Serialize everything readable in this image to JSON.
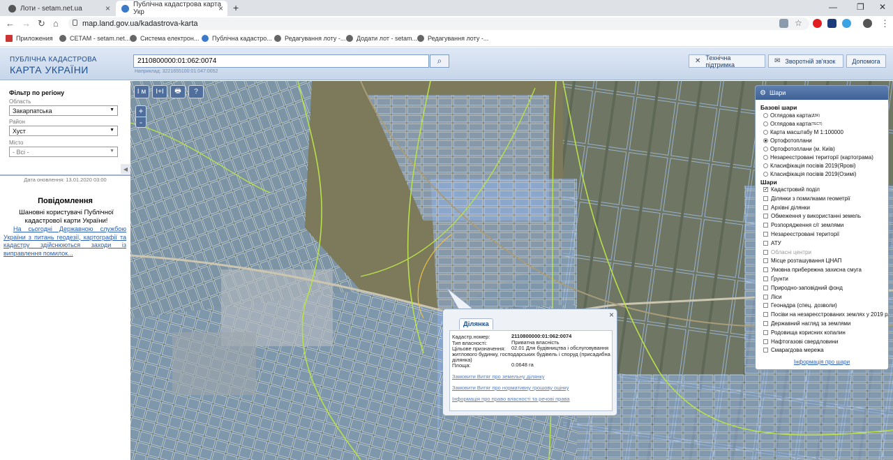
{
  "browser": {
    "tabs": [
      {
        "title": "Лоти - setam.net.ua"
      },
      {
        "title": "Публічна кадастрова карта Укр"
      }
    ],
    "new_tab": "+",
    "url": "map.land.gov.ua/kadastrova-karta",
    "bookmarks": [
      "Приложения",
      "СЕТАМ - setam.net...",
      "Система електрон...",
      "Публічна кадастро...",
      "Редагування лоту -...",
      "Додати лот - setam...",
      "Редагування лоту -..."
    ]
  },
  "header": {
    "logo_line1": "ПУБЛІЧНА КАДАСТРОВА",
    "logo_line2": "КАРТА УКРАЇНИ",
    "search_value": "2110800000:01:062:0074",
    "search_hint": "Наприклад: 3221655100:01:047:0052",
    "buttons": [
      "Технічна підтримка",
      "Зворотній зв'язок",
      "Допомога"
    ]
  },
  "filter": {
    "title": "Фільтр по регіону",
    "oblast_label": "Область",
    "oblast_value": "Закарпатська",
    "rayon_label": "Район",
    "rayon_value": "Хуст",
    "misto_label": "Місто",
    "misto_value": "- Всі -"
  },
  "left_panel": {
    "updated": "Дата оновлення: 13.01.2020 03:00",
    "news_title": "Повідомлення",
    "news_greeting": "Шановні користувачі Публічної кадастрової карти України!",
    "news_link": "На сьогодні Державною службою України з питань геодезії, картографії та кадастру здійснюються заходи із виправлення помилок..."
  },
  "map_tools": [
    "I м",
    "I+I",
    "🖶",
    "?"
  ],
  "zoom": {
    "in": "+",
    "out": "-"
  },
  "popup": {
    "tab": "Ділянка",
    "close": "×",
    "fields": [
      {
        "key": "Кадастр.номер:",
        "value": "2110800000:01:062:0074"
      },
      {
        "key": "Тип власності:",
        "value": "Приватна власність"
      },
      {
        "key": "Цільове призначення:",
        "value": "02.01 Для будівництва і обслуговування житлового будинку, господарських будівель і споруд (присадибна ділянка)"
      },
      {
        "key": "Площа:",
        "value": "0.0648 га"
      }
    ],
    "links": [
      "Замовити Витяг про земельну ділянку",
      "Замовити Витяг про нормативну грошову оцінку",
      "Інформація про право власності та речові права"
    ]
  },
  "layers": {
    "title": "Шари",
    "base_title": "Базові шари",
    "base": [
      {
        "label": "Оглядова карта",
        "sup": "(ДЗК)",
        "checked": false
      },
      {
        "label": "Оглядова карта",
        "sup": "(ТЕСТ)",
        "checked": false
      },
      {
        "label": "Карта масштабу М 1:100000",
        "sup": "",
        "checked": false
      },
      {
        "label": "Ортофотоплани",
        "sup": "",
        "checked": true
      },
      {
        "label": "Ортофотоплани (м. Київ)",
        "sup": "",
        "checked": false
      },
      {
        "label": "Незареєстровані території (картограма)",
        "sup": "",
        "checked": false
      },
      {
        "label": "Класифікація посівів 2019(Ярові)",
        "sup": "",
        "checked": false
      },
      {
        "label": "Класифікація посівів 2019(Озимі)",
        "sup": "",
        "checked": false
      }
    ],
    "overlay_title": "Шари",
    "overlays": [
      {
        "label": "Кадастровий поділ",
        "checked": true,
        "dim": false
      },
      {
        "label": "Ділянки з помилками геометрії",
        "checked": false,
        "dim": false
      },
      {
        "label": "Архівні ділянки",
        "checked": false,
        "dim": false
      },
      {
        "label": "Обмеження у використанні земель",
        "checked": false,
        "dim": false
      },
      {
        "label": "Розпорядження с/г землями",
        "checked": false,
        "dim": false
      },
      {
        "label": "Незареєстровані території",
        "checked": false,
        "dim": false
      },
      {
        "label": "АТУ",
        "checked": false,
        "dim": false
      },
      {
        "label": "Обласні центри",
        "checked": false,
        "dim": true
      },
      {
        "label": "Місце розташування ЦНАП",
        "checked": false,
        "dim": false
      },
      {
        "label": "Умовна прибережна захисна смуга",
        "checked": false,
        "dim": false
      },
      {
        "label": "Ґрунти",
        "checked": false,
        "dim": false
      },
      {
        "label": "Природно-заповідний фонд",
        "checked": false,
        "dim": false
      },
      {
        "label": "Ліси",
        "checked": false,
        "dim": false
      },
      {
        "label": "Геонадра (спец. дозволи)",
        "checked": false,
        "dim": false
      },
      {
        "label": "Посіви на незареєстрованих землях у 2019 р.",
        "checked": false,
        "dim": false
      },
      {
        "label": "Державний нагляд за землями",
        "checked": false,
        "dim": false
      },
      {
        "label": "Родовища корисних копалин",
        "checked": false,
        "dim": false
      },
      {
        "label": "Нафтогазові свердловини",
        "checked": false,
        "dim": false
      },
      {
        "label": "Смарагдова мережа",
        "checked": false,
        "dim": false
      }
    ],
    "info_link": "Інформація про шари"
  },
  "colors": {
    "accent": "#1d4f91",
    "parcel": "#8fb3e8",
    "boundary": "#b8e04a"
  }
}
